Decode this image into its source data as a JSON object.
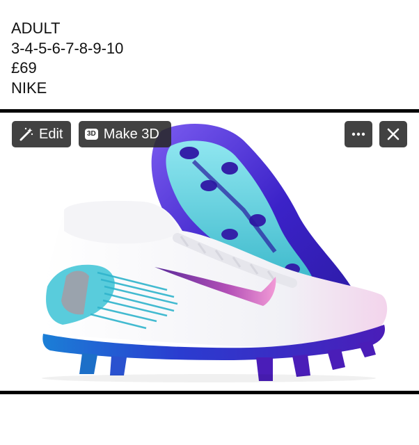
{
  "caption": {
    "lines": [
      "ADULT",
      "3-4-5-6-7-8-9-10",
      "£69",
      "NIKE"
    ]
  },
  "toolbar": {
    "edit_label": "Edit",
    "make3d_label": "Make 3D",
    "make3d_badge": "3D",
    "more_icon": "more-horizontal-icon",
    "close_icon": "close-icon",
    "edit_icon": "magic-wand-icon"
  },
  "colors": {
    "button_bg": "#282828",
    "divider": "#000000",
    "boot_upper": "#f2f2f6",
    "boot_plate": "#4f2fcf",
    "boot_accent": "#3cc3d6"
  }
}
